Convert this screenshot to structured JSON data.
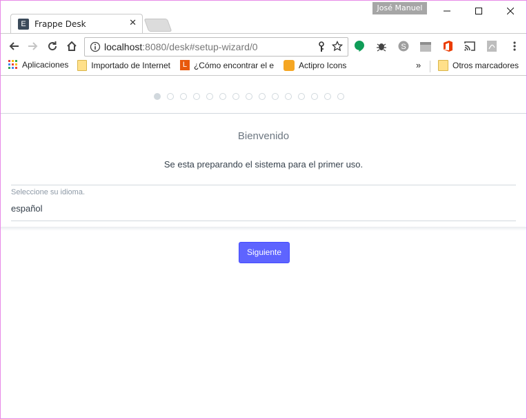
{
  "browser": {
    "profile_name": "José Manuel",
    "tab": {
      "favicon_letter": "E",
      "title": "Frappe Desk"
    },
    "url": {
      "host": "localhost",
      "rest": ":8080/desk#setup-wizard/0"
    },
    "bookmarks": [
      {
        "label": "Aplicaciones",
        "icon": "apps-grid-icon"
      },
      {
        "label": "Importado de Internet",
        "icon": "folder-icon"
      },
      {
        "label": "¿Cómo encontrar el e",
        "icon": "L-orange-icon"
      },
      {
        "label": "Actipro Icons",
        "icon": "actipro-icon"
      },
      {
        "label": "»",
        "icon": "chevron-more"
      },
      {
        "label": "Otros marcadores",
        "icon": "folder-icon"
      }
    ]
  },
  "wizard": {
    "steps_total": 15,
    "active_step": 1,
    "title": "Bienvenido",
    "subtitle": "Se esta preparando el sistema para el primer uso.",
    "language_label": "Seleccione su idioma.",
    "language_value": "español",
    "next_label": "Siguiente"
  },
  "colors": {
    "primary": "#5e64ff",
    "border": "#d1d8dd",
    "muted": "#8d99a6"
  }
}
